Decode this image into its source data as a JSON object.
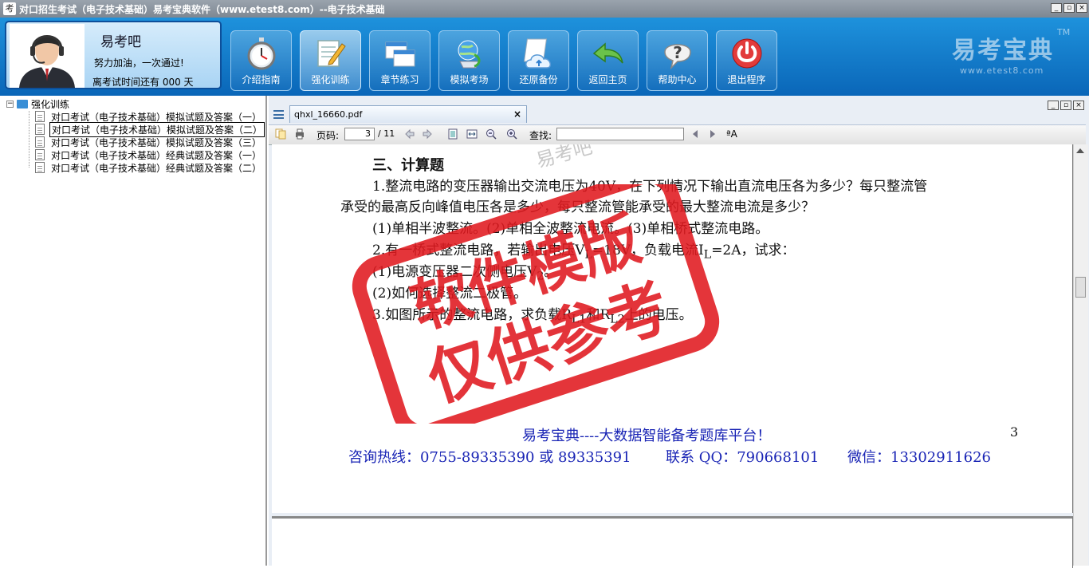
{
  "window": {
    "title": "对口招生考试（电子技术基础）易考宝典软件（www.etest8.com）--电子技术基础",
    "app_icon": "考",
    "controls": [
      "_",
      "▫",
      "×"
    ]
  },
  "user": {
    "name": "易考吧",
    "motto": "努力加油，一次通过!",
    "countdown": "离考试时间还有 000 天"
  },
  "toolbar": {
    "buttons": [
      {
        "label": "介绍指南",
        "icon": "stopwatch-icon"
      },
      {
        "label": "强化训练",
        "icon": "notepad-pencil-icon"
      },
      {
        "label": "章节练习",
        "icon": "windows-stack-icon"
      },
      {
        "label": "模拟考场",
        "icon": "globe-refresh-icon"
      },
      {
        "label": "还原备份",
        "icon": "cloud-backup-icon"
      },
      {
        "label": "返回主页",
        "icon": "back-arrow-icon"
      },
      {
        "label": "帮助中心",
        "icon": "help-question-icon"
      },
      {
        "label": "退出程序",
        "icon": "power-icon"
      }
    ],
    "active_index": 1
  },
  "brand": {
    "name": "易考宝典",
    "tm": "TM",
    "url": "www.etest8.com"
  },
  "tree": {
    "expander": "−",
    "root": "强化训练",
    "items": [
      "对口考试（电子技术基础）模拟试题及答案（一）",
      "对口考试（电子技术基础）模拟试题及答案（二）",
      "对口考试（电子技术基础）模拟试题及答案（三）",
      "对口考试（电子技术基础）经典试题及答案（一）",
      "对口考试（电子技术基础）经典试题及答案（二）"
    ],
    "selected_index": 1
  },
  "viewer": {
    "tab_name": "qhxl_16660.pdf",
    "tab_close": "×",
    "page_label": "页码:",
    "current_page": "3",
    "total_pages": "/ 11",
    "find_label": "查找:",
    "find_value": "",
    "text_size_glyph": "ªA"
  },
  "document": {
    "watermark_top": "易考吧",
    "heading": "三、计算题",
    "lines": [
      "1.整流电路的变压器输出交流电压为40V，在下列情况下输出直流电压各为多少？每只整流管",
      "承受的最高反向峰值电压各是多少，每只整流管能承受的最大整流电流是多少？",
      "(1)单相半波整流。(2)单相全波整流电流。(3)单相桥式整流电路。",
      "2.有一桥式整流电路，若输出电压V",
      "(1)电源变压器二次侧电压V",
      "(2)如何选择整流二极管。",
      "3.如图所示的整流电路，求负载R"
    ],
    "line4_sub": "L",
    "line4_rest": "=18V，负载电流I",
    "line4_sub2": "L",
    "line4_end": "=2A，试求：",
    "line5_sub": "2",
    "line5_end": "。",
    "line7_sub": "L1",
    "line7_mid": "和R",
    "line7_sub2": "L2",
    "line7_end": "上的电压。",
    "footer_slogan": "易考宝典----大数据智能备考题库平台！",
    "page_number": "3",
    "contact": {
      "hotline": "咨询热线：0755-89335390 或 89335391",
      "qq": "联系 QQ：790668101",
      "wechat": "微信：13302911626"
    },
    "stamp_line1": "软件模版",
    "stamp_line2": "仅供参考"
  },
  "colors": {
    "stamp": "#e0191f",
    "footer_text": "#1a25b5",
    "toolbar_top": "#1e92dc",
    "toolbar_bottom": "#0a66b8"
  }
}
